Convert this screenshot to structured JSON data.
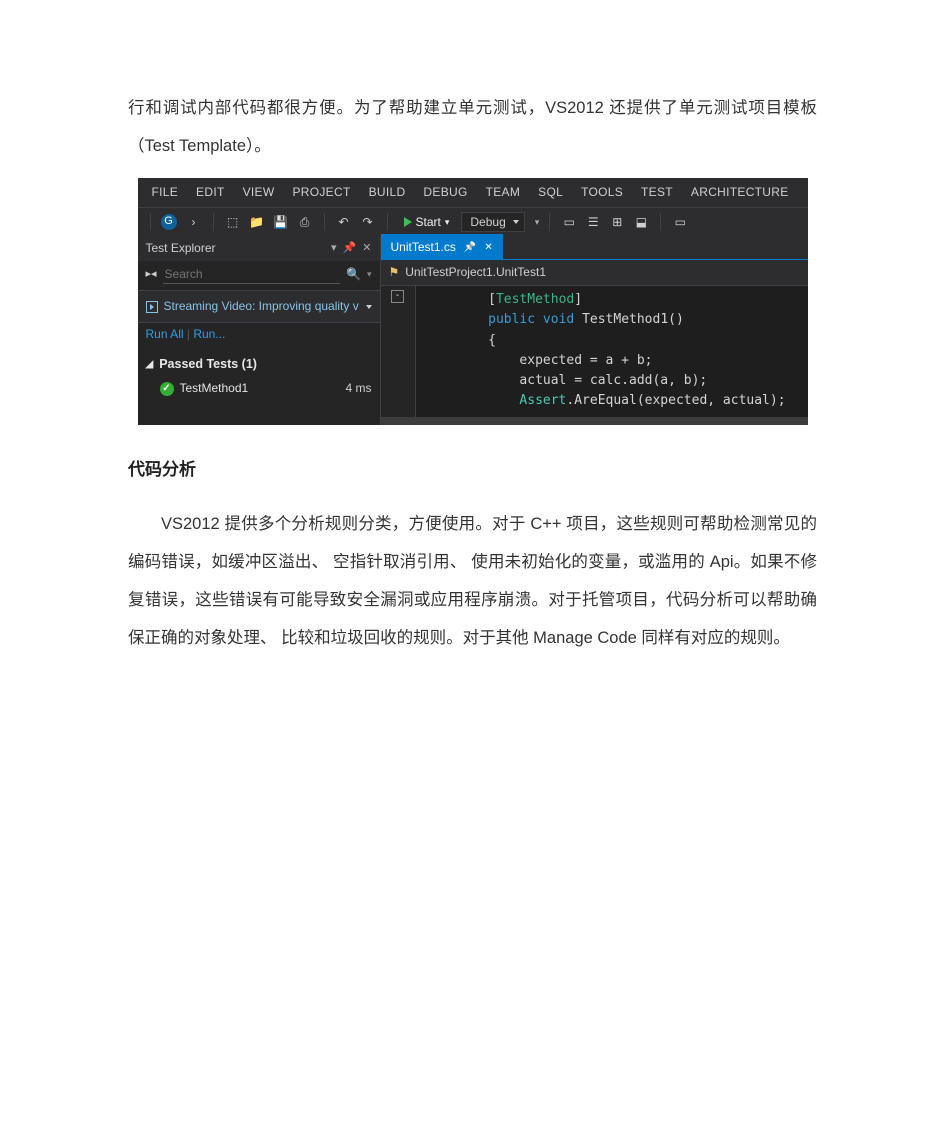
{
  "text": {
    "p1": "行和调试内部代码都很方便。为了帮助建立单元测试，VS2012 还提供了单元测试项目模板（Test  Template）。",
    "h1": "代码分析",
    "p2": "VS2012 提供多个分析规则分类，方便使用。对于  C++  项目，这些规则可帮助检测常见的编码错误，如缓冲区溢出、  空指针取消引用、  使用未初始化的变量，或滥用的 Api。如果不修复错误，这些错误有可能导致安全漏洞或应用程序崩溃。对于托管项目，代码分析可以帮助确保正确的对象处理、  比较和垃圾回收的规则。对于其他 Manage  Code 同样有对应的规则。"
  },
  "vs": {
    "menu": [
      "FILE",
      "EDIT",
      "VIEW",
      "PROJECT",
      "BUILD",
      "DEBUG",
      "TEAM",
      "SQL",
      "TOOLS",
      "TEST",
      "ARCHITECTURE"
    ],
    "toolbar": {
      "start": "Start",
      "config": "Debug"
    },
    "testExplorer": {
      "title": "Test Explorer",
      "searchPlaceholder": "Search",
      "streaming": "Streaming Video: Improving quality v",
      "runAll": "Run All",
      "run": "Run...",
      "passed": "Passed Tests (1)",
      "test1": "TestMethod1",
      "test1ms": "4 ms"
    },
    "editor": {
      "tab": "UnitTest1.cs",
      "crumb": "UnitTestProject1.UnitTest1",
      "code": {
        "l1a": "[",
        "l1b": "TestMethod",
        "l1c": "]",
        "l2a": "public",
        "l2b": "void",
        "l2c": "TestMethod1",
        "l2d": "()",
        "l3": "{",
        "l4": "expected = a + b;",
        "l5a": "actual = calc.add(a, b);",
        "l6a": "Assert",
        "l6b": ".AreEqual(expected, actual);"
      }
    }
  }
}
